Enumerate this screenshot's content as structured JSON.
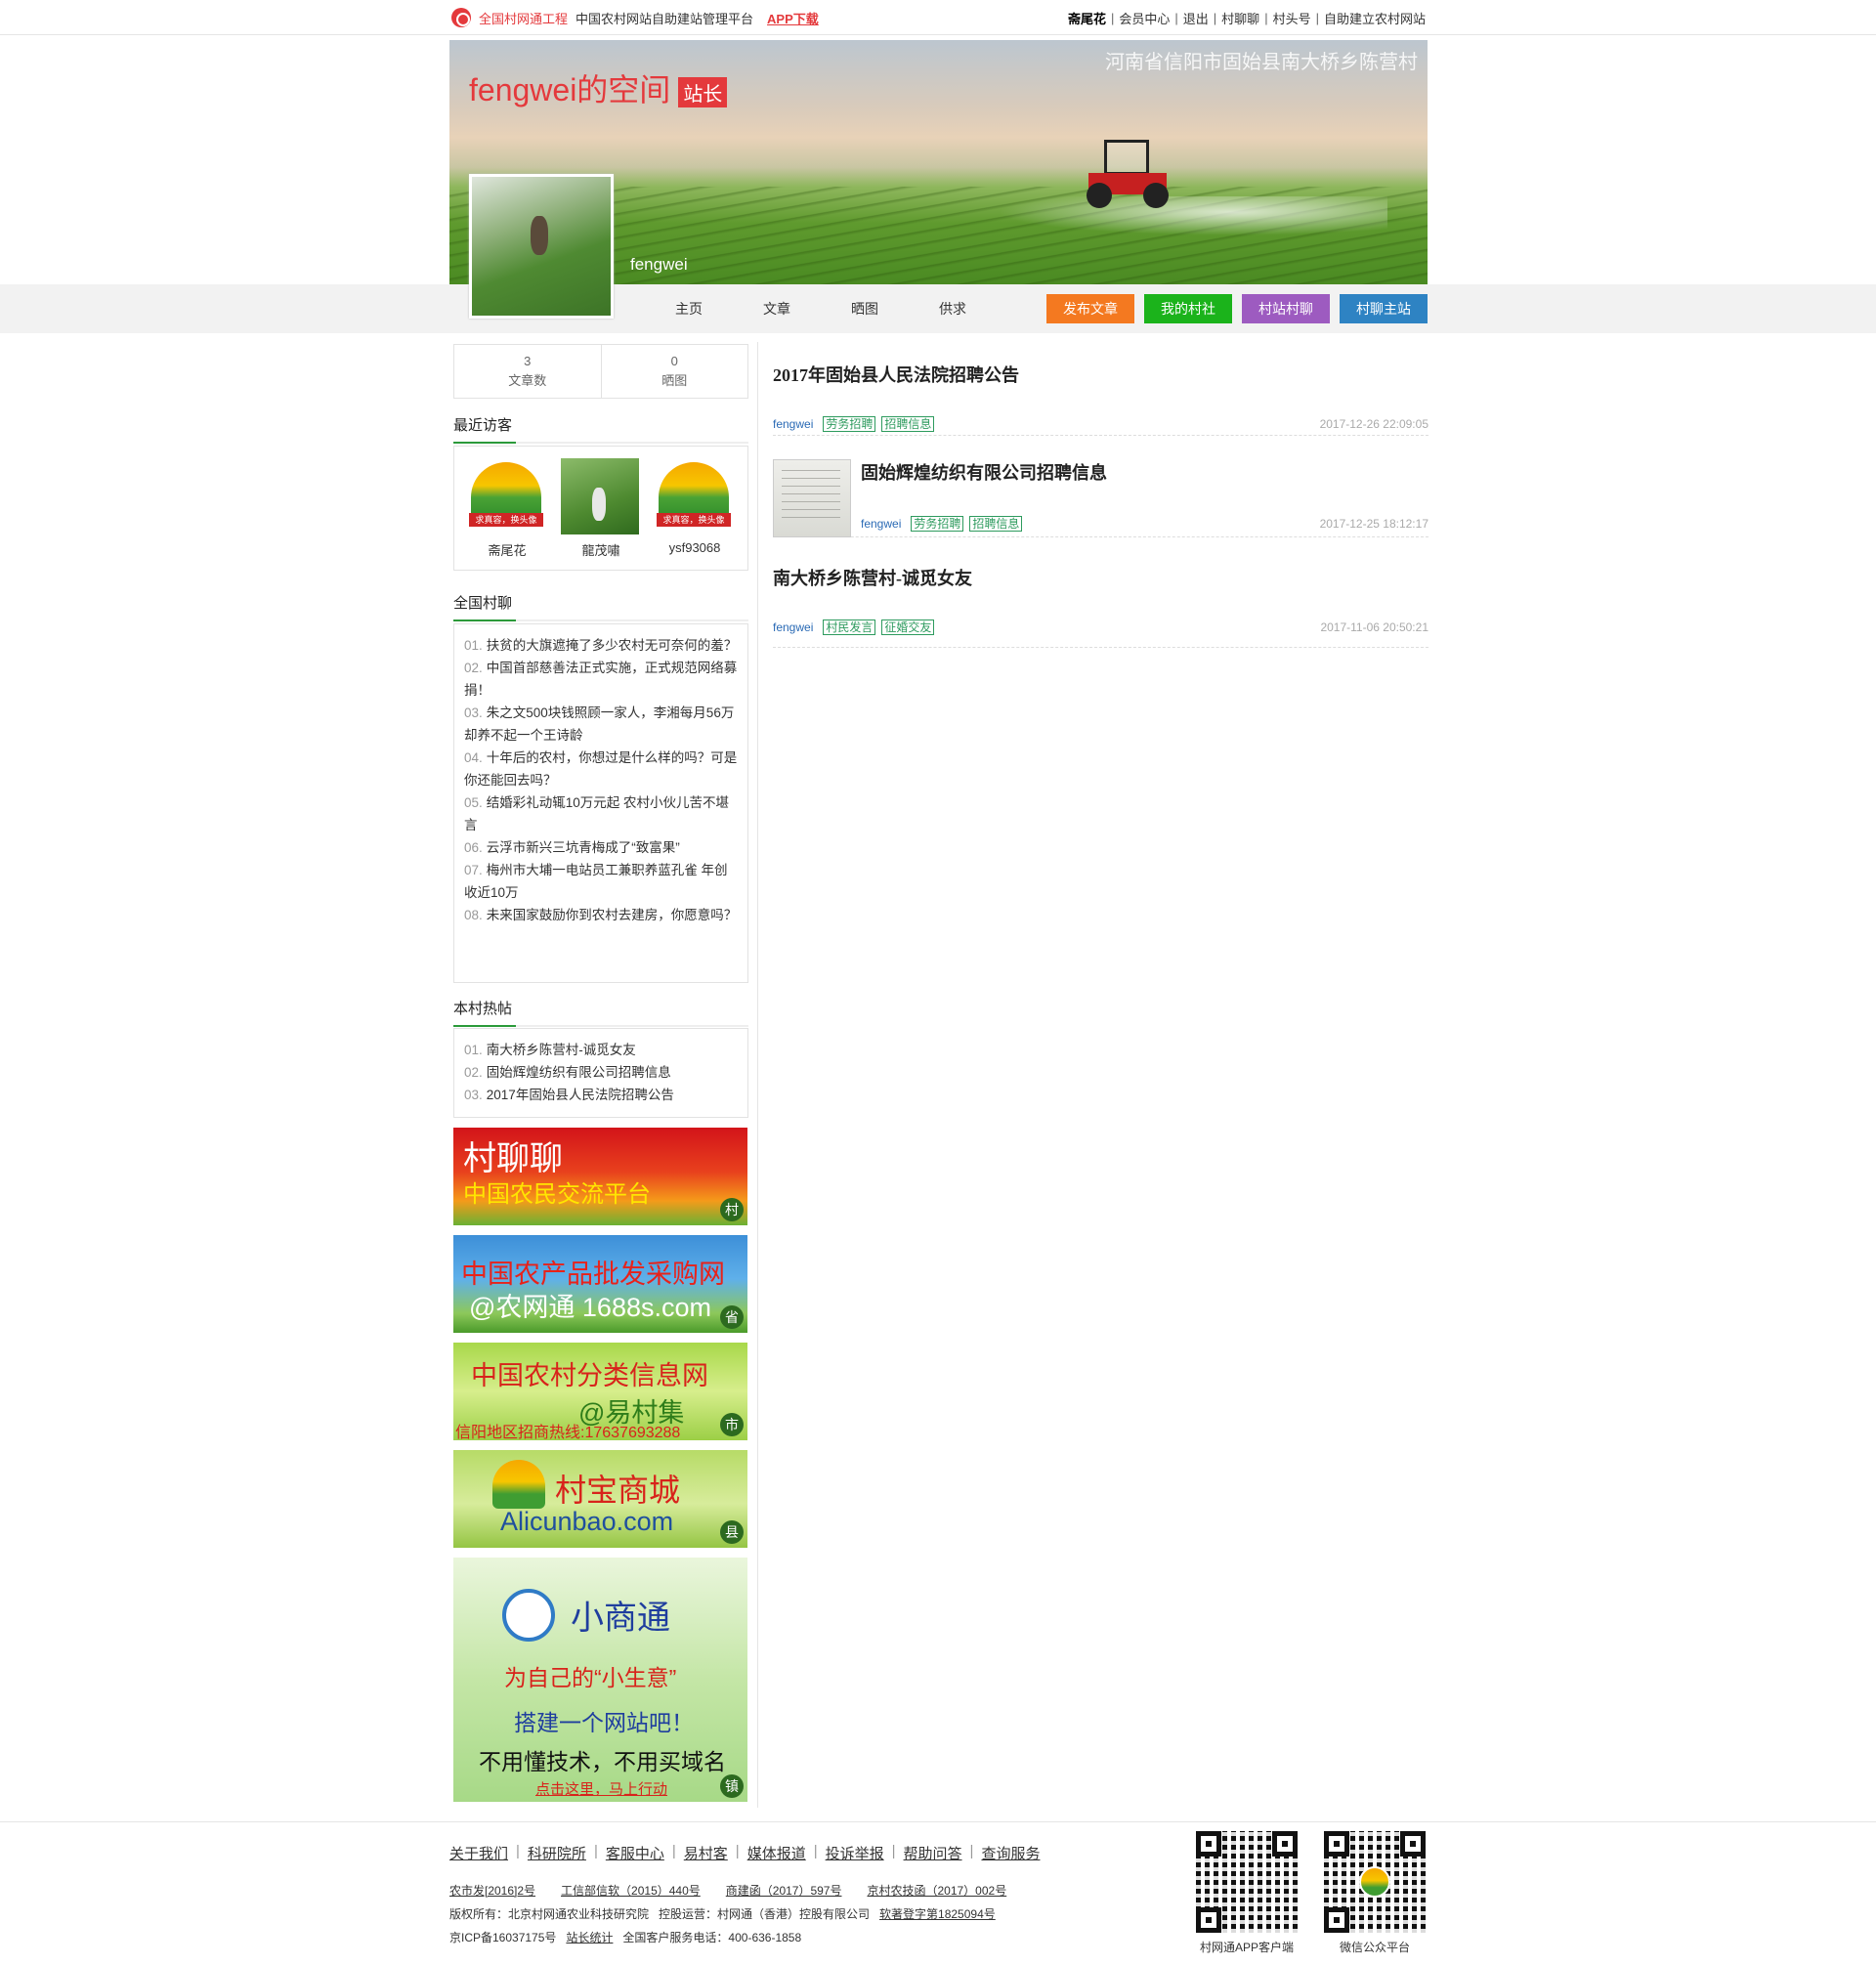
{
  "topbar": {
    "brand": "全国村网通工程",
    "slogan": "中国农村网站自助建站管理平台",
    "app_download": "APP下载",
    "user": "斋尾花",
    "links": [
      "会员中心",
      "退出",
      "村聊聊",
      "村头号",
      "自助建立农村网站"
    ]
  },
  "banner": {
    "space_title": "fengwei的空间",
    "role": "站长",
    "location": "河南省信阳市固始县南大桥乡陈营村",
    "username": "fengwei"
  },
  "nav": {
    "links": [
      "主页",
      "文章",
      "晒图",
      "供求"
    ],
    "buttons": [
      "发布文章",
      "我的村社",
      "村站村聊",
      "村聊主站"
    ],
    "button_colors": [
      "#f47920",
      "#1bb31b",
      "#9d5bc0",
      "#2e83c3"
    ]
  },
  "stats": {
    "articles_count": "3",
    "articles_label": "文章数",
    "photos_count": "0",
    "photos_label": "晒图"
  },
  "visitors": {
    "title": "最近访客",
    "items": [
      {
        "name": "斋尾花",
        "avatar": "default-logo"
      },
      {
        "name": "龍茂嘯",
        "avatar": "photo"
      },
      {
        "name": "ysf93068",
        "avatar": "default-logo"
      }
    ]
  },
  "national_chat": {
    "title": "全国村聊",
    "items": [
      {
        "num": "01.",
        "text": "扶贫的大旗遮掩了多少农村无可奈何的羞？"
      },
      {
        "num": "02.",
        "text": "中国首部慈善法正式实施，正式规范网络募捐！"
      },
      {
        "num": "03.",
        "text": "朱之文500块钱照顾一家人，李湘每月56万却养不起一个王诗龄"
      },
      {
        "num": "04.",
        "text": "十年后的农村，你想过是什么样的吗？可是你还能回去吗？"
      },
      {
        "num": "05.",
        "text": "结婚彩礼动辄10万元起 农村小伙儿苦不堪言"
      },
      {
        "num": "06.",
        "text": "云浮市新兴三坑青梅成了“致富果”"
      },
      {
        "num": "07.",
        "text": "梅州市大埔一电站员工兼职养蓝孔雀 年创收近10万"
      },
      {
        "num": "08.",
        "text": "未来国家鼓励你到农村去建房，你愿意吗？"
      }
    ]
  },
  "hot_posts": {
    "title": "本村热帖",
    "items": [
      {
        "num": "01.",
        "text": "南大桥乡陈营村-诚觅女友"
      },
      {
        "num": "02.",
        "text": "固始辉煌纺织有限公司招聘信息"
      },
      {
        "num": "03.",
        "text": "2017年固始县人民法院招聘公告"
      }
    ]
  },
  "ads": {
    "ad1": {
      "line1": "村聊聊",
      "line2": "中国农民交流平台",
      "tag": "村"
    },
    "ad2": {
      "line1": "中国农产品批发采购网",
      "line2": "@农网通 1688s.com",
      "tag": "省"
    },
    "ad3": {
      "line1": "中国农村分类信息网",
      "line2": "@易村集",
      "line3": "信阳地区招商热线:17637693288",
      "tag": "市"
    },
    "ad4": {
      "line1": "村宝商城",
      "line2": "Alicunbao.com",
      "tag": "县"
    },
    "ad5": {
      "line1": "小商通",
      "line2": "为自己的“小生意”",
      "line3": "搭建一个网站吧！",
      "line4": "不用懂技术，不用买域名",
      "line5": "点击这里，马上行动",
      "tag": "镇"
    }
  },
  "articles": [
    {
      "title": "2017年固始县人民法院招聘公告",
      "author": "fengwei",
      "tags": [
        "劳务招聘",
        "招聘信息"
      ],
      "date": "2017-12-26 22:09:05",
      "has_thumb": false
    },
    {
      "title": "固始辉煌纺织有限公司招聘信息",
      "author": "fengwei",
      "tags": [
        "劳务招聘",
        "招聘信息"
      ],
      "date": "2017-12-25 18:12:17",
      "has_thumb": true
    },
    {
      "title": "南大桥乡陈营村-诚觅女友",
      "author": "fengwei",
      "tags": [
        "村民发言",
        "征婚交友"
      ],
      "date": "2017-11-06 20:50:21",
      "has_thumb": false
    }
  ],
  "footer": {
    "links": [
      "关于我们",
      "科研院所",
      "客服中心",
      "易村客",
      "媒体报道",
      "投诉举报",
      "帮助问答",
      "查询服务"
    ],
    "row1": [
      "农市发[2016]2号",
      "工信部信软（2015）440号",
      "商建函（2017）597号",
      "京村农技函（2017）002号"
    ],
    "row2_a": "版权所有：北京村网通农业科技研究院",
    "row2_b": "控股运营：村网通（香港）控股有限公司",
    "row2_c": "软著登字第1825094号",
    "row3_a": "京ICP备16037175号",
    "row3_b": "站长统计",
    "row3_c": "全国客户服务电话：400-636-1858",
    "qr1_caption": "村网通APP客户端",
    "qr2_caption": "微信公众平台"
  }
}
